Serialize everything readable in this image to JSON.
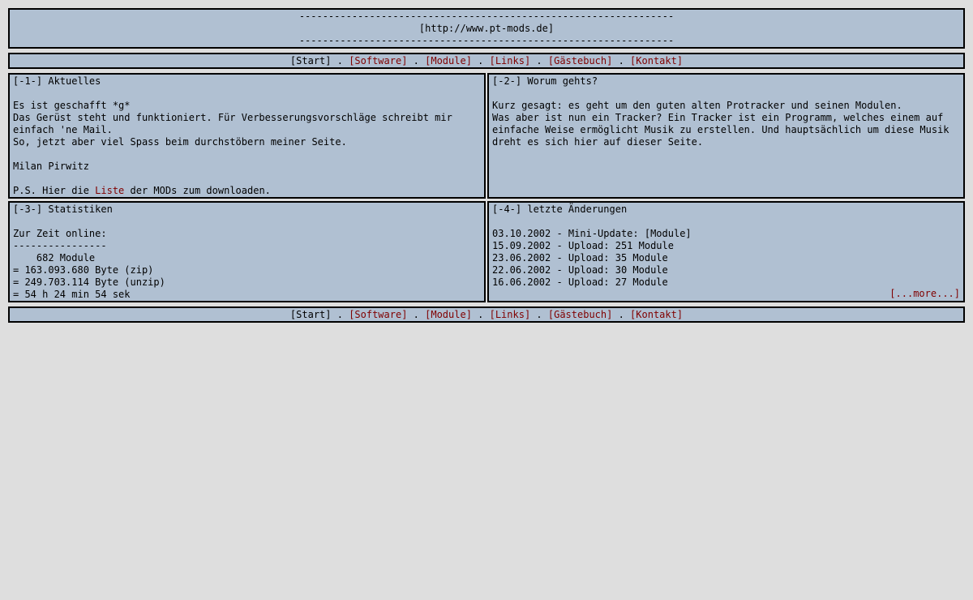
{
  "header": {
    "dashes": "----------------------------------------------------------------",
    "url": "[http://www.pt-mods.de]"
  },
  "nav": [
    {
      "label": "[Start]",
      "current": true
    },
    {
      "label": "[Software]"
    },
    {
      "label": "[Module]"
    },
    {
      "label": "[Links]"
    },
    {
      "label": "[Gästebuch]"
    },
    {
      "label": "[Kontakt]"
    }
  ],
  "nav_separator": " . ",
  "panel1": {
    "title": "[-1-] Aktuelles",
    "line1": "Es ist geschafft *g*",
    "line2": "Das Gerüst steht und funktioniert. Für Verbesserungsvorschläge schreibt mir",
    "line3": "einfach 'ne Mail.",
    "line4": "So, jetzt aber viel Spass beim durchstöbern meiner Seite.",
    "signature": "Milan Pirwitz",
    "ps_before": "P.S. Hier die ",
    "ps_link": "Liste",
    "ps_after": " der MODs zum downloaden."
  },
  "panel2": {
    "title": "[-2-] Worum gehts?",
    "line1": "Kurz gesagt: es geht um den guten alten Protracker und seinen Modulen.",
    "line2": "Was aber ist nun ein Tracker? Ein Tracker ist ein Programm, welches einem auf",
    "line3": "einfache Weise ermöglicht Musik zu erstellen. Und hauptsächlich um diese Musik",
    "line4": "dreht es sich hier auf dieser Seite."
  },
  "panel3": {
    "title": "[-3-] Statistiken",
    "label": "Zur Zeit online:",
    "rule": "----------------",
    "modules": "    682 Module",
    "zip": "= 163.093.680 Byte (zip)",
    "unzip": "= 249.703.114 Byte (unzip)",
    "duration": "= 54 h 24 min 54 sek"
  },
  "panel4": {
    "title": "[-4-] letzte Änderungen",
    "changes": [
      "03.10.2002 - Mini-Update: [Module]",
      "15.09.2002 - Upload: 251 Module",
      "23.06.2002 - Upload: 35 Module",
      "22.06.2002 - Upload: 30 Module",
      "16.06.2002 - Upload: 27 Module"
    ],
    "more": "[...more...]"
  }
}
